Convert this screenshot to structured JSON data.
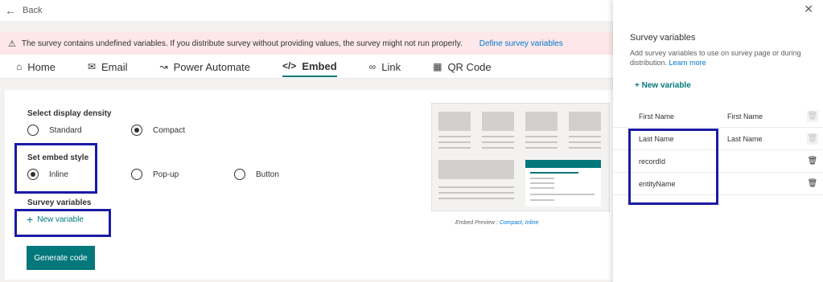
{
  "topbar": {
    "back_label": "Back"
  },
  "warning": {
    "message": "The survey contains undefined variables. If you distribute survey without providing values, the survey might not run properly.",
    "link": "Define survey variables"
  },
  "tabs": [
    {
      "label": "Home",
      "icon": "home-icon",
      "active": false
    },
    {
      "label": "Email",
      "icon": "mail-icon",
      "active": false
    },
    {
      "label": "Power Automate",
      "icon": "flow-icon",
      "active": false
    },
    {
      "label": "Embed",
      "icon": "code-icon",
      "active": true
    },
    {
      "label": "Link",
      "icon": "link-icon",
      "active": false
    },
    {
      "label": "QR Code",
      "icon": "qr-code-icon",
      "active": false
    }
  ],
  "density": {
    "label": "Select display density",
    "options": [
      "Standard",
      "Compact"
    ],
    "selected": "Compact"
  },
  "embed_style": {
    "label": "Set embed style",
    "options": [
      "Inline",
      "Pop-up",
      "Button"
    ],
    "selected": "Inline"
  },
  "survey_variables": {
    "label": "Survey variables",
    "new_variable": "New variable"
  },
  "generate_button": "Generate code",
  "preview": {
    "caption_prefix": "Embed Preview : ",
    "caption_value": "Compact, Inline"
  },
  "panel": {
    "title": "Survey variables",
    "description": "Add survey variables to use on survey page or during distribution.",
    "learn_more": "Learn more",
    "new_variable": "+ New variable",
    "variables": [
      {
        "name": "First Name",
        "value": "First Name",
        "deletable": false
      },
      {
        "name": "Last Name",
        "value": "Last Name",
        "deletable": false
      },
      {
        "name": "recordId",
        "value": "",
        "deletable": true
      },
      {
        "name": "entityName",
        "value": "",
        "deletable": true
      }
    ]
  },
  "colors": {
    "accent": "#03787c",
    "link": "#0078d4",
    "warning_bg": "#fde7e9",
    "highlight": "#1a1aa6"
  }
}
